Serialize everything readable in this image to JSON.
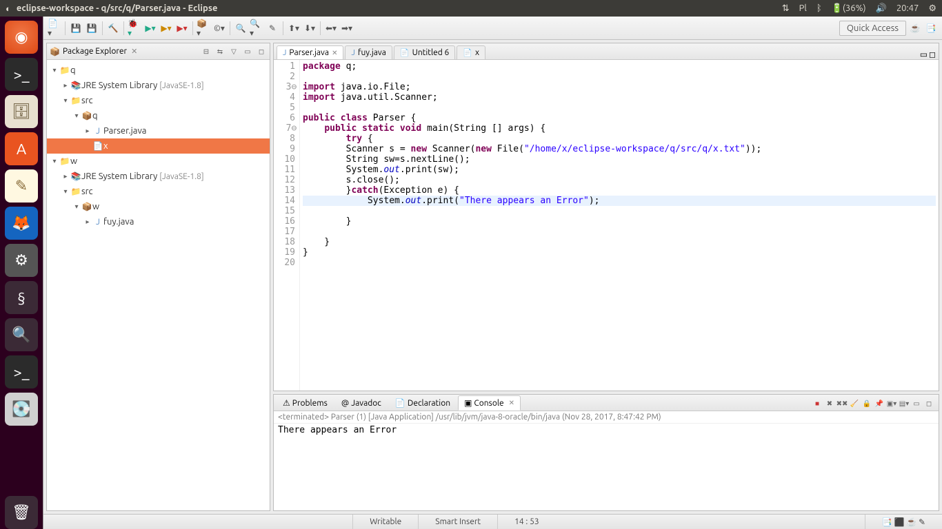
{
  "menubar": {
    "title": "eclipse-workspace - q/src/q/Parser.java - Eclipse",
    "lang": "Pl",
    "battery": "(36%)",
    "time": "20:47"
  },
  "launcher": {
    "items": [
      {
        "name": "ubuntu",
        "glyph": "◉"
      },
      {
        "name": "terminal",
        "glyph": ">_"
      },
      {
        "name": "files",
        "glyph": "🗄"
      },
      {
        "name": "software",
        "glyph": "A"
      },
      {
        "name": "text-editor",
        "glyph": "✎"
      },
      {
        "name": "firefox",
        "glyph": "🦊"
      },
      {
        "name": "settings",
        "glyph": "⚙"
      },
      {
        "name": "spring",
        "glyph": "§"
      },
      {
        "name": "search",
        "glyph": "🔍"
      },
      {
        "name": "terminal2",
        "glyph": ">_"
      },
      {
        "name": "disk",
        "glyph": "💽"
      },
      {
        "name": "trash",
        "glyph": "🗑"
      }
    ]
  },
  "toolbar": {
    "quick_access": "Quick Access"
  },
  "package_explorer": {
    "title": "Package Explorer",
    "projects": [
      {
        "name": "q",
        "jre": "JRE System Library",
        "jre_ver": "[JavaSE-1.8]",
        "src": "src",
        "pkg": "q",
        "files": [
          "Parser.java",
          "x"
        ]
      },
      {
        "name": "w",
        "jre": "JRE System Library",
        "jre_ver": "[JavaSE-1.8]",
        "src": "src",
        "pkg": "w",
        "files": [
          "fuy.java"
        ]
      }
    ]
  },
  "editor_tabs": [
    {
      "label": "Parser.java",
      "active": true
    },
    {
      "label": "fuy.java",
      "active": false
    },
    {
      "label": "Untitled 6",
      "active": false
    },
    {
      "label": "x",
      "active": false
    }
  ],
  "code": {
    "lines": 19,
    "l1_kw": "package",
    "l1_rest": " q;",
    "l3_kw": "import",
    "l3_rest": " java.io.File;",
    "l4_kw": "import",
    "l4_rest": " java.util.Scanner;",
    "l6a": "public",
    "l6b": "class",
    "l6_rest": " Parser {",
    "l7a": "public",
    "l7b": "static",
    "l7c": "void",
    "l7_rest": " main(String [] args) {",
    "l8a": "try",
    "l8_rest": " {",
    "l9_pre": "        Scanner s = ",
    "l9_new1": "new",
    "l9_mid": " Scanner(",
    "l9_new2": "new",
    "l9_mid2": " File(",
    "l9_str": "\"/home/x/eclipse-workspace/q/src/q/x.txt\"",
    "l9_end": "));",
    "l10": "        String sw=s.nextLine();",
    "l11_pre": "        System.",
    "l11_out": "out",
    "l11_rest": ".print(sw);",
    "l12": "        s.close();",
    "l13_pre": "        }",
    "l13_catch": "catch",
    "l13_rest": "(Exception e) {",
    "l14_pre": "            System.",
    "l14_out": "out",
    "l14_mid": ".print(",
    "l14_str": "\"There appears an Error\"",
    "l14_end": ");",
    "l16": "        }",
    "l18": "    }",
    "l19": "}"
  },
  "bottom_tabs": {
    "problems": "Problems",
    "javadoc": "Javadoc",
    "declaration": "Declaration",
    "console": "Console"
  },
  "console": {
    "header": "<terminated> Parser (1) [Java Application] /usr/lib/jvm/java-8-oracle/bin/java (Nov 28, 2017, 8:47:42 PM)",
    "output": "There appears an Error"
  },
  "status": {
    "writable": "Writable",
    "insert": "Smart Insert",
    "pos": "14 : 53"
  }
}
